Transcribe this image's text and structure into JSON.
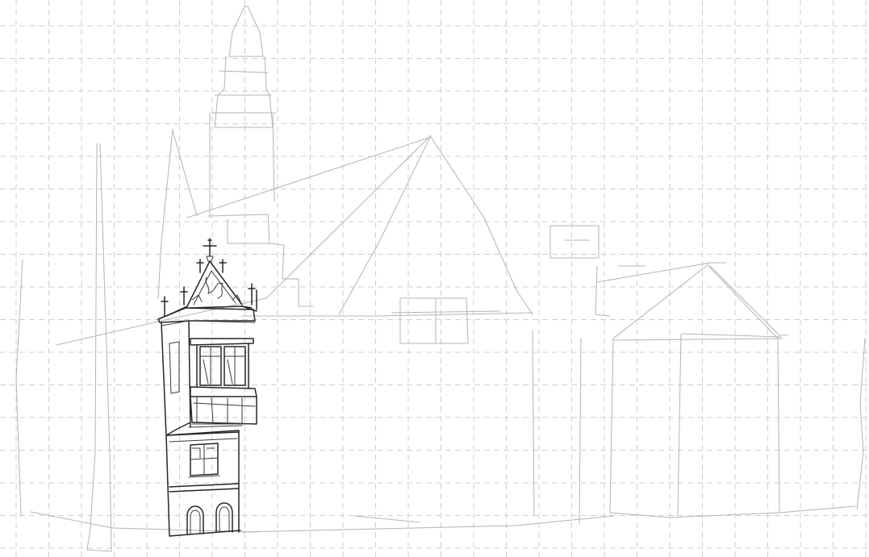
{
  "image": {
    "subject": "pencil sketch",
    "background": "#ffffff",
    "colors": {
      "grid": "#cfcfcf",
      "ink": "#262626",
      "construction": "#b4b4b4"
    },
    "grid": true
  }
}
